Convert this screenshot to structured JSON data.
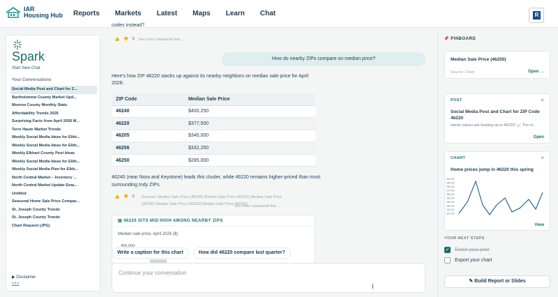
{
  "app": {
    "logo_line1": "IAR",
    "logo_line2": "Housing Hub"
  },
  "nav": [
    "Reports",
    "Markets",
    "Latest",
    "Maps",
    "Learn",
    "Chat"
  ],
  "sidebar": {
    "title": "Spark",
    "new_chat": "Start New Chat",
    "conversations_header": "Your Conversations",
    "conversations": [
      "Social Media Post and Chart for Z...",
      "Bartholomew County Market Upd...",
      "Monroe County Monthly Stats",
      "Affordability Trends 2026",
      "Surprising Facts from April 2026 M...",
      "Terre Haute Market Trends",
      "Weekly Social Media Ideas for Elkh...",
      "Weekly Social Media Ideas for Elkh...",
      "Weekly Elkhart County Post Ideas",
      "Weekly Social Media Ideas for Elkh...",
      "Weekly Social Media Plan for Elkh...",
      "North Central Market – Inventory ...",
      "North Central Market Update Ema...",
      "Untitled",
      "Seasonal Home Sale Price Compar...",
      "St. Joseph County Trends",
      "St. Joseph County Trends",
      "Chart Request (JPG)"
    ],
    "disclaimer": "Disclaimer",
    "version": "V3.0"
  },
  "chat": {
    "prev_tail": "codes instead?",
    "see_how": "See how I answered this...",
    "user_message": "How do nearby ZIPs compare on median price?",
    "intro": "Here's how ZIP 46220 stacks up against its nearby neighbors on median sale price for April 2026:",
    "table": {
      "headers": [
        "ZIP Code",
        "Median Sale Price"
      ],
      "rows": [
        [
          "46240",
          "$400,250"
        ],
        [
          "46220",
          "$377,500"
        ],
        [
          "46205",
          "$340,000"
        ],
        [
          "46256",
          "$332,250"
        ],
        [
          "46250",
          "$285,000"
        ]
      ]
    },
    "summary": "46240 (near Nora and Keystone) leads this cluster, while 46220 remains higher-priced than most surrounding Indy ZIPs.",
    "sources_label": "Sources:",
    "sources": [
      "Median Sale Price (46256)",
      "Median Sale Price (46250)",
      "Median Sale Price (46240)",
      "Median Sale Price (46220)",
      "Median Sale Price (46205)"
    ],
    "chart_card": {
      "header": "46220 SITS MID-HIGH AMONG NEARBY ZIPS",
      "subtitle": "Median sale price, April 2026 ($)",
      "first_tick": "450,000"
    },
    "suggestions": [
      "Write a caption for this chart",
      "How did 46220 compare last quarter?"
    ],
    "input_placeholder": "Continue your conversation"
  },
  "pinboard": {
    "header": "PINBOARD",
    "card1": {
      "title": "Median Sale Price (46250)",
      "source": "Source: Chart",
      "action": "Open →"
    },
    "card2": {
      "tag": "POST",
      "title": "Social Media Post and Chart for ZIP Code 46220",
      "preview": "Home values are heating up in 46220! 📈 The m...",
      "action": "Open"
    },
    "card3": {
      "tag": "CHART",
      "title": "Home prices jump in 46220 this spring",
      "action": "View",
      "yticks": [
        "400,000",
        "390,000",
        "380,000",
        "370,000",
        "360,000",
        "350,000",
        "340,000",
        "330,000",
        "320,000",
        "310,000",
        "300,000"
      ]
    },
    "next_steps_header": "YOUR NEXT STEPS",
    "steps": [
      {
        "label": "Finish your post",
        "done": true
      },
      {
        "label": "Export your chart",
        "done": false
      }
    ],
    "build_button": "Build Report or Slides"
  },
  "colors": {
    "accent": "#1a6d6b",
    "user_bubble": "#dfeeee",
    "nav_text": "#1f3a4d"
  }
}
